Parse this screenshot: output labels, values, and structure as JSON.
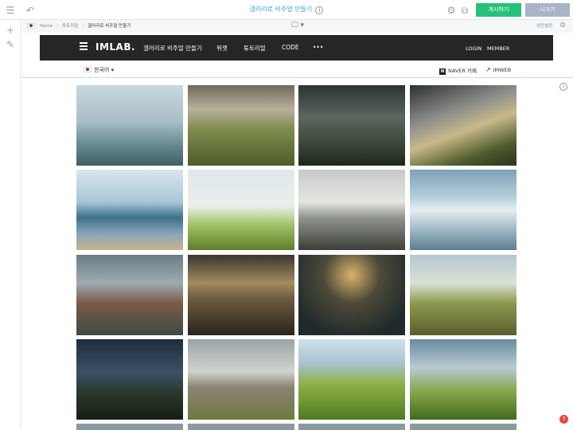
{
  "topbar": {
    "menu_icon": "hamburger-icon",
    "undo_icon": "undo-icon",
    "title": "갤러리로 비주얼 만들기",
    "settings_icon": "gear-icon",
    "external_icon": "external-link-icon",
    "publish_label": "게시하기",
    "exit_label": "나가기"
  },
  "breadcrumb": {
    "items": [
      "Home",
      "튜토리얼",
      "갤러리로 비주얼 만들기"
    ],
    "top_setting": "상단설정"
  },
  "site": {
    "logo": "IMLAB.",
    "menu": [
      "갤러리로 비주얼 만들기",
      "위젯",
      "튜토리얼",
      "CODE",
      "•••"
    ],
    "right": [
      "LOGIN",
      "MEMBER"
    ],
    "language": "한국어 ▾",
    "links": [
      {
        "icon": "N",
        "label": "NAVER 카페"
      },
      {
        "icon": "↗",
        "label": "IMWEB"
      }
    ]
  },
  "colors": {
    "accent": "#3aa6e0",
    "publish": "#25c27a",
    "exit": "#a9b4c8",
    "nav": "#262626"
  },
  "gallery": {
    "tiles": [
      {
        "scene": "trees-in-lake",
        "bg": "linear-gradient(180deg,#c9d7de 0%,#a8bfc8 45%,#6f9197 70%,#3f5f63 100%)"
      },
      {
        "scene": "mountain-valley",
        "bg": "linear-gradient(180deg,#6f6a5c 0%,#b8b09a 30%,#7e8b4c 55%,#4d5e2a 100%)"
      },
      {
        "scene": "stormy-field",
        "bg": "linear-gradient(180deg,#2c3432 0%,#5b6660 40%,#3e4a3c 70%,#1f261d 100%)"
      },
      {
        "scene": "storm-road",
        "bg": "linear-gradient(160deg,#2e3133 0%,#8c8e8a 35%,#c9b98a 55%,#4f5a2c 80%,#2d331b 100%)"
      },
      {
        "scene": "cracked-ice",
        "bg": "linear-gradient(180deg,#d8e6ee 0%,#a9c6d8 40%,#3f6f8c 60%,#8aa7b8 80%,#c9b48a 100%)"
      },
      {
        "scene": "floating-island",
        "bg": "linear-gradient(180deg,#dfe8ec 0%,#e9efe9 45%,#9fbf62 70%,#5d7d2a 100%)"
      },
      {
        "scene": "piano-shore",
        "bg": "linear-gradient(180deg,#c6c9c6 0%,#e4e6e2 40%,#8f938c 60%,#3c3f39 100%)"
      },
      {
        "scene": "mirror-lake",
        "bg": "linear-gradient(180deg,#7ea0b6 0%,#b6cfdc 35%,#e6eef0 50%,#9db8c6 75%,#5c7d90 100%)"
      },
      {
        "scene": "red-cabin",
        "bg": "linear-gradient(180deg,#6d7b83 0%,#9eabb1 35%,#7b5a47 60%,#3f4a45 100%)"
      },
      {
        "scene": "old-boots",
        "bg": "linear-gradient(180deg,#3a3530 0%,#a58b5e 35%,#6b5a3e 55%,#2a241d 100%)"
      },
      {
        "scene": "attic-room",
        "bg": "radial-gradient(circle at 50% 25%,#d9b26a 0%,#4d4a3a 35%,#1f2a2a 80%)"
      },
      {
        "scene": "country-road",
        "bg": "linear-gradient(180deg,#b4c7cf 0%,#dbe1d6 35%,#8c9a4c 60%,#5b5d2e 100%)"
      },
      {
        "scene": "night-doors",
        "bg": "linear-gradient(180deg,#1f2c3a 0%,#3b5066 40%,#2a3528 70%,#151d13 100%)"
      },
      {
        "scene": "brick-factory",
        "bg": "linear-gradient(180deg,#9aa4a6 0%,#cfd3cd 40%,#8a8373 60%,#6e7a3e 100%)"
      },
      {
        "scene": "green-hills",
        "bg": "linear-gradient(180deg,#cfe1ea 0%,#a7c2cf 30%,#8fb24a 55%,#4f7a1f 100%)"
      },
      {
        "scene": "ladder-sky",
        "bg": "linear-gradient(180deg,#6c8aa0 0%,#b8cbd3 35%,#86a84a 65%,#416a1f 100%)"
      }
    ]
  }
}
